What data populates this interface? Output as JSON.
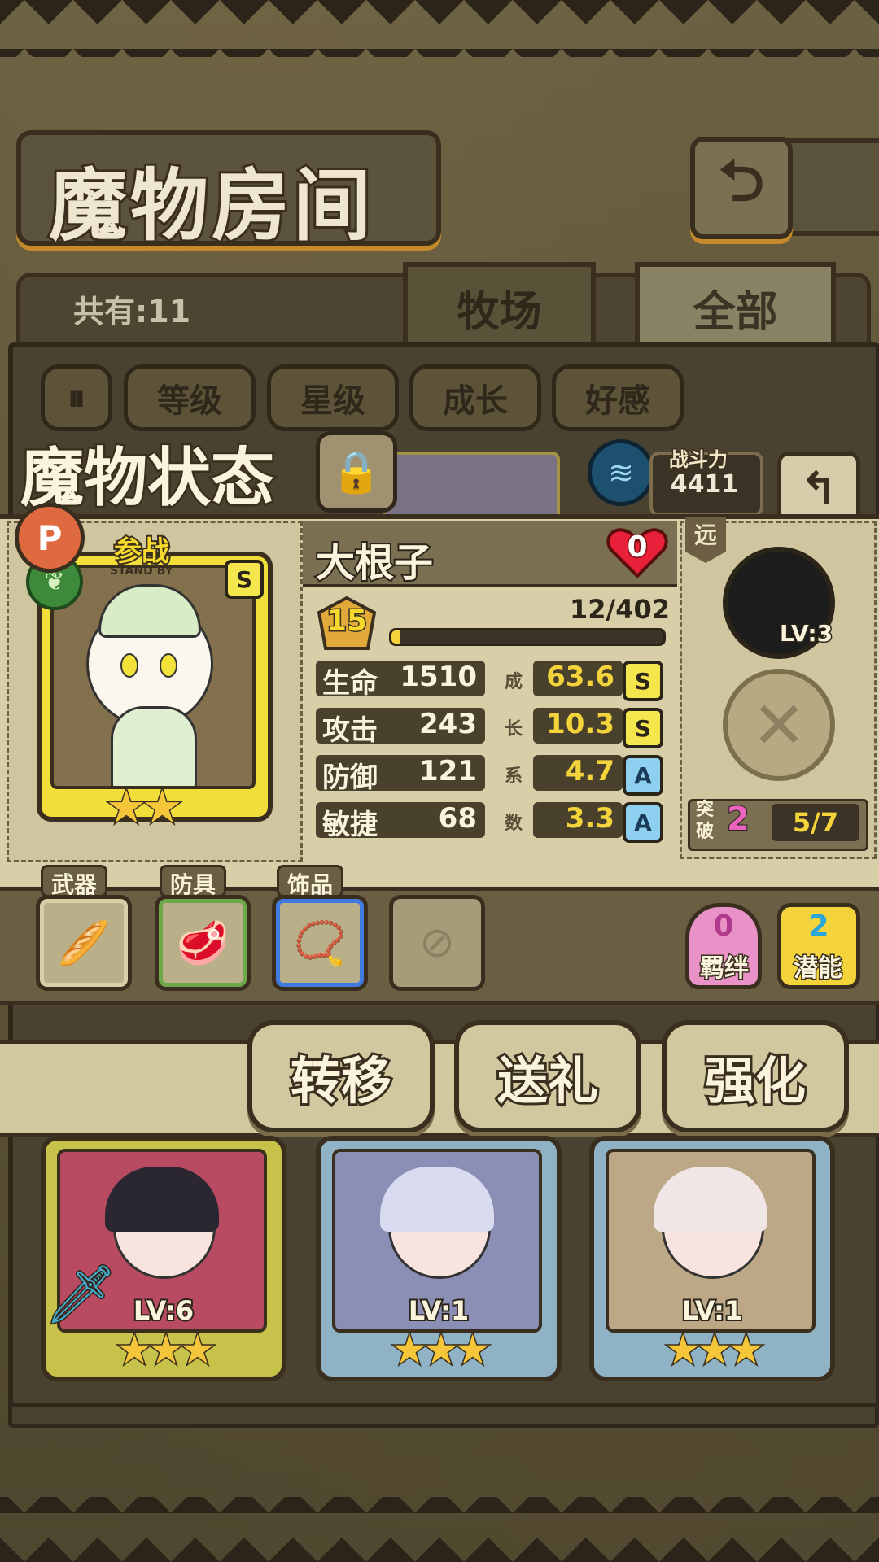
{
  "header": {
    "title": "魔物房间",
    "back_icon": "return-icon"
  },
  "tabs": {
    "count_text": "共有:11",
    "ranch": "牧场",
    "all": "全部"
  },
  "sort": {
    "toggle": "⏸",
    "level": "等级",
    "star": "星级",
    "growth": "成长",
    "affinity": "好感"
  },
  "status": {
    "title": "魔物状态",
    "power_label": "战斗力",
    "power_value": "4411",
    "standby_label": "参战",
    "standby_sub": "STAND BY",
    "rank": "S",
    "name": "大根子",
    "affection": "0",
    "level": "15",
    "exp_text": "12/402",
    "exp_progress": 0.03,
    "range": "远",
    "skill_level": "LV:3",
    "breakthrough_label": "突破",
    "breakthrough_value": "2",
    "breakthrough_progress": "5/7",
    "stars": "★★",
    "stats": [
      {
        "label": "生命",
        "value": "1510",
        "growth": "63.6",
        "grade": "S"
      },
      {
        "label": "攻击",
        "value": "243",
        "growth": "10.3",
        "grade": "S"
      },
      {
        "label": "防御",
        "value": "121",
        "growth": "4.7",
        "grade": "A"
      },
      {
        "label": "敏捷",
        "value": "68",
        "growth": "3.3",
        "grade": "A"
      }
    ],
    "growth_chars": [
      "成",
      "长",
      "系",
      "数"
    ]
  },
  "equipment": {
    "weapon": "武器",
    "armor": "防具",
    "accessory": "饰品",
    "bond_value": "0",
    "bond_label": "羁绊",
    "potential_value": "2",
    "potential_label": "潜能"
  },
  "actions": {
    "transfer": "转移",
    "gift": "送礼",
    "enhance": "强化"
  },
  "cards": [
    {
      "level": "LV:6",
      "stars": "★★★"
    },
    {
      "level": "LV:1",
      "stars": "★★★"
    },
    {
      "level": "LV:1",
      "stars": "★★★"
    }
  ]
}
